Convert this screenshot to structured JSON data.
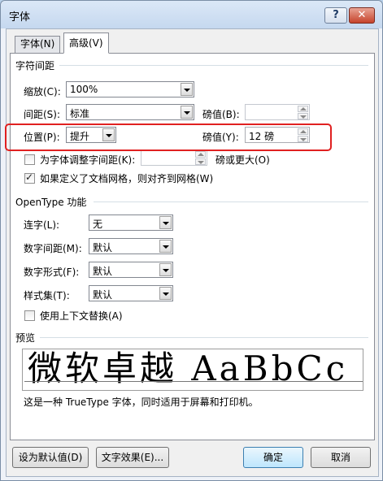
{
  "window": {
    "title": "字体",
    "help_label": "?",
    "close_label": "✕"
  },
  "tabs": [
    {
      "label": "字体(N)",
      "active": false
    },
    {
      "label": "高级(V)",
      "active": true
    }
  ],
  "spacing_group": {
    "title": "字符间距",
    "scale_label": "缩放(C):",
    "scale_value": "100%",
    "spacing_label": "间距(S):",
    "spacing_value": "标准",
    "spacing_points_label": "磅值(B):",
    "spacing_points_value": "",
    "position_label": "位置(P):",
    "position_value": "提升",
    "position_points_label": "磅值(Y):",
    "position_points_value": "12 磅",
    "kerning_label": "为字体调整字间距(K):",
    "kerning_value": "",
    "kerning_suffix": "磅或更大(O)",
    "kerning_checked": false,
    "grid_label": "如果定义了文档网格，则对齐到网格(W)",
    "grid_checked": true
  },
  "opentype_group": {
    "title": "OpenType 功能",
    "ligatures_label": "连字(L):",
    "ligatures_value": "无",
    "num_spacing_label": "数字间距(M):",
    "num_spacing_value": "默认",
    "num_forms_label": "数字形式(F):",
    "num_forms_value": "默认",
    "stylistic_label": "样式集(T):",
    "stylistic_value": "默认",
    "contextual_label": "使用上下文替换(A)",
    "contextual_checked": false
  },
  "preview": {
    "title": "预览",
    "sample_text": "微软卓越  AaBbCc",
    "description": "这是一种 TrueType 字体，同时适用于屏幕和打印机。"
  },
  "buttons": {
    "set_default": "设为默认值(D)",
    "text_effects": "文字效果(E)...",
    "ok": "确定",
    "cancel": "取消"
  },
  "colors": {
    "highlight": "#e02020",
    "close": "#c6432b"
  }
}
